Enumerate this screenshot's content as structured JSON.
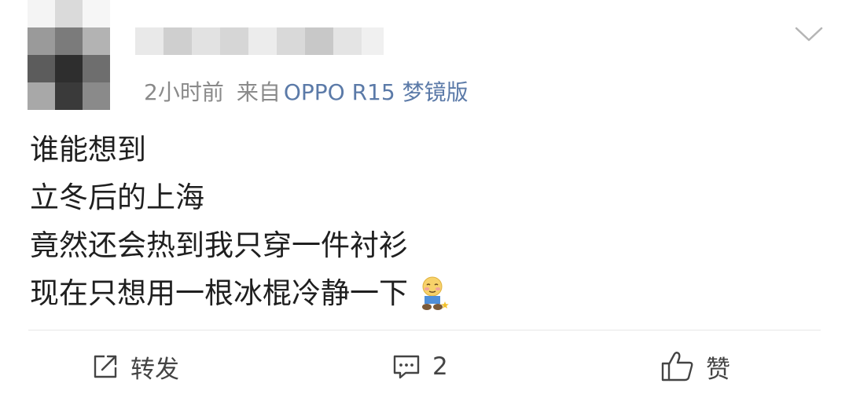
{
  "post": {
    "meta": {
      "time": "2小时前",
      "from_label": "来自",
      "device": "OPPO R15 梦镜版"
    },
    "content_lines": [
      "谁能想到",
      "立冬后的上海",
      "竟然还会热到我只穿一件衬衫",
      "现在只想用一根冰棍冷静一下"
    ],
    "emoji_icon": "shy-person-emoji",
    "actions": {
      "repost_label": "转发",
      "repost_icon": "repost-icon",
      "comment_count": "2",
      "comment_icon": "comment-icon",
      "like_label": "赞",
      "like_icon": "thumbs-up-icon"
    },
    "colors": {
      "text": "#1f1f1f",
      "meta_gray": "#8a8a8a",
      "device_link_blue": "#5b7aa8",
      "action_gray": "#444444",
      "divider": "#e6e6e6"
    }
  }
}
